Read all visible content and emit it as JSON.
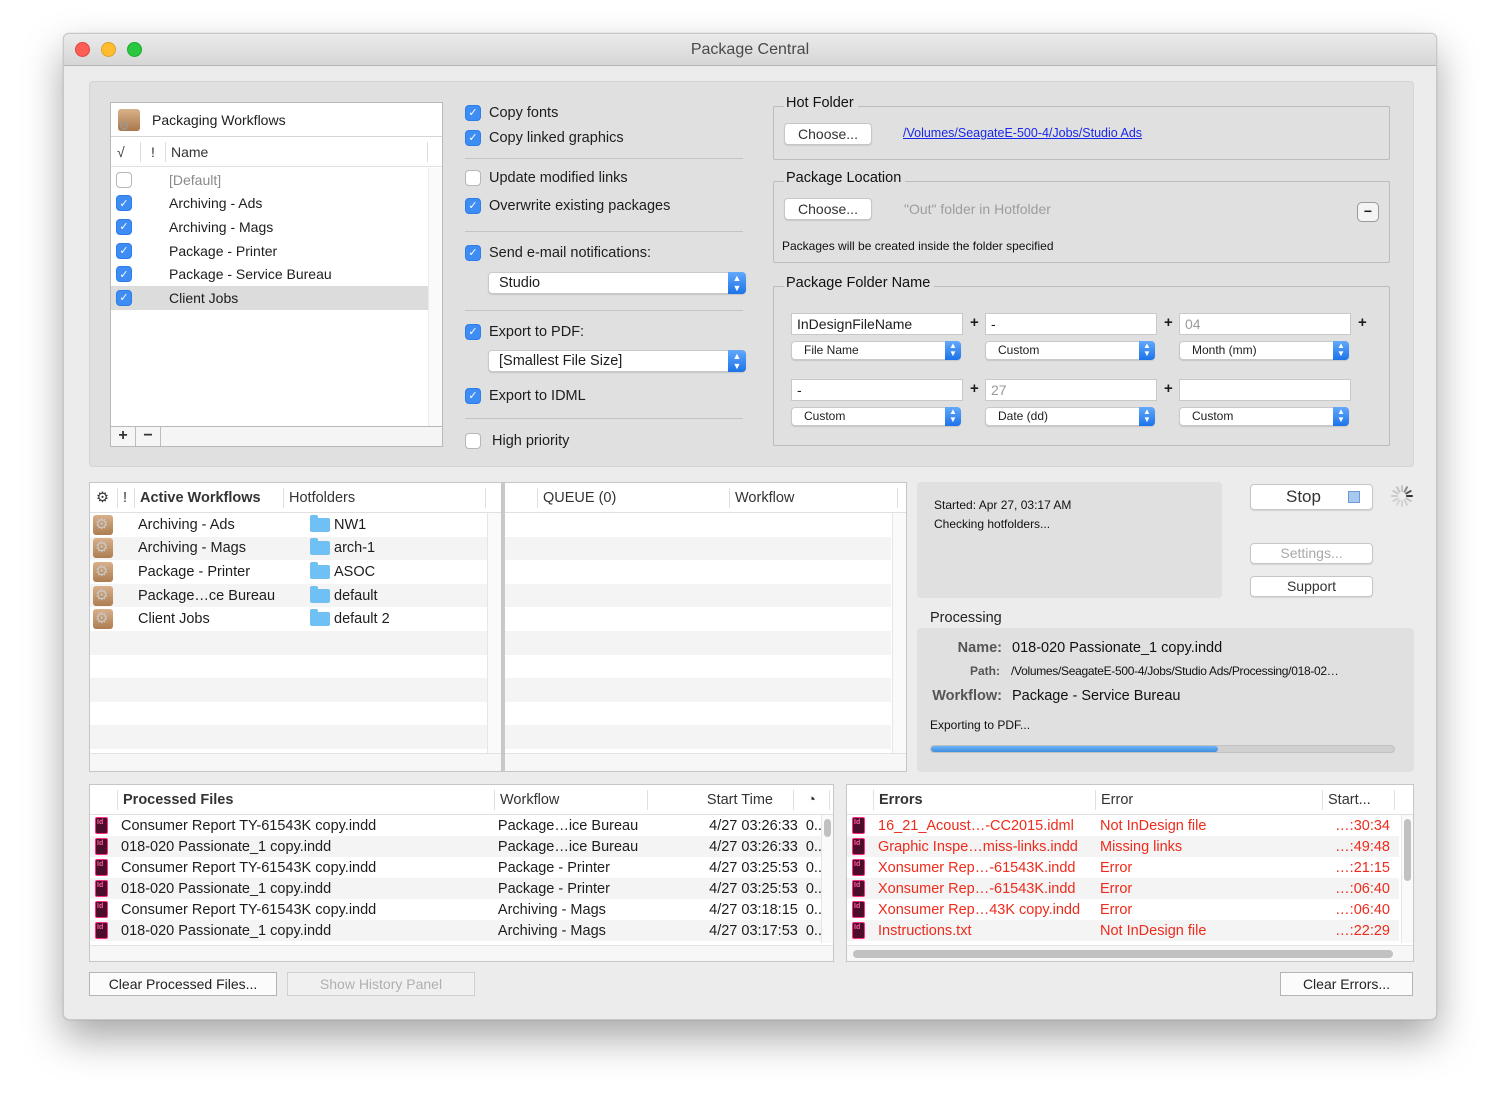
{
  "window": {
    "title": "Package Central"
  },
  "packaging_workflows": {
    "title": "Packaging Workflows",
    "columns": {
      "check": "√",
      "flag": "!",
      "name": "Name"
    },
    "items": [
      {
        "name": "[Default]",
        "checked": false,
        "dim": true,
        "selected": false
      },
      {
        "name": "Archiving - Ads",
        "checked": true,
        "dim": false,
        "selected": false
      },
      {
        "name": "Archiving - Mags",
        "checked": true,
        "dim": false,
        "selected": false
      },
      {
        "name": "Package - Printer",
        "checked": true,
        "dim": false,
        "selected": false
      },
      {
        "name": "Package - Service Bureau",
        "checked": true,
        "dim": false,
        "selected": false
      },
      {
        "name": "Client Jobs",
        "checked": true,
        "dim": false,
        "selected": true
      }
    ],
    "add_label": "+",
    "remove_label": "−"
  },
  "options": {
    "copy_fonts": {
      "label": "Copy fonts",
      "checked": true
    },
    "copy_linked_graphics": {
      "label": "Copy linked graphics",
      "checked": true
    },
    "update_modified_links": {
      "label": "Update modified links",
      "checked": false
    },
    "overwrite_existing": {
      "label": "Overwrite existing packages",
      "checked": true
    },
    "send_email": {
      "label": "Send e-mail notifications:",
      "checked": true
    },
    "email_select": "Studio",
    "export_pdf": {
      "label": "Export to PDF:",
      "checked": true
    },
    "pdf_preset_select": "[Smallest File Size]",
    "export_idml": {
      "label": "Export to IDML",
      "checked": true
    },
    "high_priority": {
      "label": "High priority",
      "checked": false
    }
  },
  "hot_folder": {
    "label": "Hot Folder",
    "choose_label": "Choose...",
    "path": "/Volumes/SeagateE-500-4/Jobs/Studio Ads"
  },
  "package_location": {
    "label": "Package Location",
    "choose_label": "Choose...",
    "placeholder": "\"Out\" folder in Hotfolder",
    "remove_label": "−",
    "hint": "Packages will be created inside the folder specified"
  },
  "package_folder_name": {
    "label": "Package Folder Name",
    "plus": "+",
    "parts": [
      {
        "value": "InDesignFileName",
        "dim": false,
        "type": "File Name"
      },
      {
        "value": "-",
        "dim": false,
        "type": "Custom"
      },
      {
        "value": "04",
        "dim": true,
        "type": "Month (mm)"
      },
      {
        "value": "-",
        "dim": false,
        "type": "Custom"
      },
      {
        "value": "27",
        "dim": true,
        "type": "Date (dd)"
      },
      {
        "value": "",
        "dim": false,
        "type": "Custom"
      }
    ]
  },
  "active_workflows": {
    "columns": {
      "gear": "gear-icon",
      "flag": "!",
      "name": "Active Workflows",
      "hotfolders": "Hotfolders"
    },
    "rows": [
      {
        "name": "Archiving - Ads",
        "hotfolder": "NW1"
      },
      {
        "name": "Archiving - Mags",
        "hotfolder": "arch-1"
      },
      {
        "name": "Package - Printer",
        "hotfolder": "ASOC"
      },
      {
        "name": "Package…ce Bureau",
        "hotfolder": "default"
      },
      {
        "name": "Client Jobs",
        "hotfolder": "default 2"
      }
    ]
  },
  "queue": {
    "columns": {
      "queue": "QUEUE (0)",
      "workflow": "Workflow"
    },
    "rows": []
  },
  "status": {
    "started": "Started: Apr 27, 03:17 AM",
    "message": "Checking hotfolders..."
  },
  "controls": {
    "stop_label": "Stop",
    "settings_label": "Settings...",
    "support_label": "Support"
  },
  "processing": {
    "label": "Processing",
    "name_key": "Name:",
    "name_value": "018-020 Passionate_1 copy.indd",
    "path_key": "Path:",
    "path_value": "/Volumes/SeagateE-500-4/Jobs/Studio Ads/Processing/018-02…",
    "workflow_key": "Workflow:",
    "workflow_value": "Package - Service Bureau",
    "step": "Exporting to PDF...",
    "progress_percent": 62
  },
  "processed_files": {
    "columns": {
      "file": "Processed Files",
      "workflow": "Workflow",
      "start": "Start Time",
      "duration": "clock-icon"
    },
    "rows": [
      {
        "file": "Consumer Report TY-61543K copy.indd",
        "workflow": "Package…ice Bureau",
        "start": "4/27 03:26:33",
        "duration": "0...."
      },
      {
        "file": "018-020 Passionate_1 copy.indd",
        "workflow": "Package…ice Bureau",
        "start": "4/27 03:26:33",
        "duration": "0...."
      },
      {
        "file": "Consumer Report TY-61543K copy.indd",
        "workflow": "Package - Printer",
        "start": "4/27 03:25:53",
        "duration": "0...."
      },
      {
        "file": "018-020 Passionate_1 copy.indd",
        "workflow": "Package - Printer",
        "start": "4/27 03:25:53",
        "duration": "0...."
      },
      {
        "file": "Consumer Report TY-61543K copy.indd",
        "workflow": "Archiving - Mags",
        "start": "4/27 03:18:15",
        "duration": "0...."
      },
      {
        "file": "018-020 Passionate_1 copy.indd",
        "workflow": "Archiving - Mags",
        "start": "4/27 03:17:53",
        "duration": "0...."
      }
    ]
  },
  "errors": {
    "columns": {
      "file": "Errors",
      "error": "Error",
      "start": "Start..."
    },
    "rows": [
      {
        "file": "16_21_Acoust…-CC2015.idml",
        "error": "Not InDesign file",
        "start": "…:30:34"
      },
      {
        "file": "Graphic Inspe…miss-links.indd",
        "error": "Missing links",
        "start": "…:49:48"
      },
      {
        "file": "Xonsumer Rep…-61543K.indd",
        "error": "Error",
        "start": "…:21:15"
      },
      {
        "file": "Xonsumer Rep…-61543K.indd",
        "error": "Error",
        "start": "…:06:40"
      },
      {
        "file": "Xonsumer Rep…43K copy.indd",
        "error": "Error",
        "start": "…:06:40"
      },
      {
        "file": "Instructions.txt",
        "error": "Not InDesign file",
        "start": "…:22:29"
      }
    ]
  },
  "footer": {
    "clear_processed_label": "Clear Processed Files...",
    "show_history_label": "Show History Panel",
    "clear_errors_label": "Clear Errors..."
  },
  "colors": {
    "accent": "#3d8df5",
    "error": "#ee2b1c",
    "link": "#1a27e8",
    "progress": "#4a97e6"
  }
}
